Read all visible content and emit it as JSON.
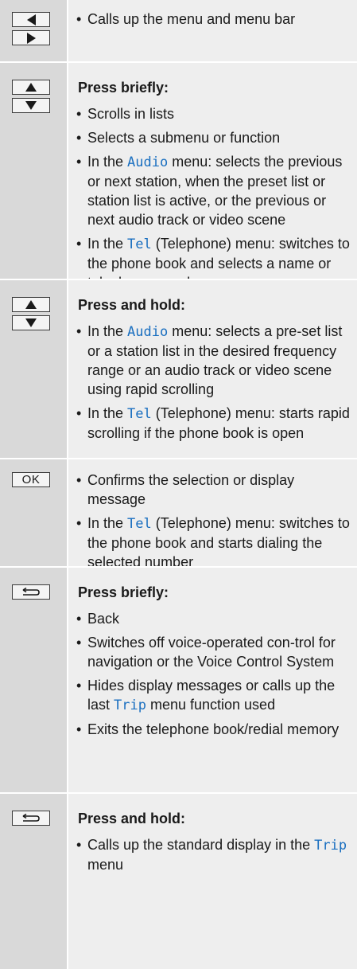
{
  "rows": [
    {
      "keys": [
        "left-arrow",
        "right-arrow"
      ],
      "heading": "",
      "items": [
        {
          "parts": [
            "Calls up the menu and menu bar"
          ]
        }
      ]
    },
    {
      "keys": [
        "up-arrow",
        "down-arrow"
      ],
      "heading": "Press briefly:",
      "items": [
        {
          "parts": [
            "Scrolls in lists"
          ]
        },
        {
          "parts": [
            "Selects a submenu or function"
          ]
        },
        {
          "pre": "In the ",
          "hl": "Audio",
          "post": " menu: selects the previous or next station, when the preset list or station list is active, or the previous or next audio track or video scene"
        },
        {
          "pre": "In the ",
          "hl": "Tel",
          "post": " (Telephone) menu: switches to the phone book and selects a name or telephone num-ber"
        }
      ]
    },
    {
      "keys": [
        "up-arrow",
        "down-arrow"
      ],
      "heading": "Press and hold:",
      "items": [
        {
          "pre": "In the ",
          "hl": "Audio",
          "post": " menu: selects a pre-set list or a station list in the desired frequency range or an audio track or video scene using rapid scrolling"
        },
        {
          "pre": "In the ",
          "hl": "Tel",
          "post": " (Telephone) menu: starts rapid scrolling if the phone book is open"
        }
      ]
    },
    {
      "keys": [
        "ok"
      ],
      "ok_label": "OK",
      "heading": "",
      "items": [
        {
          "parts": [
            "Confirms the selection or display message"
          ]
        },
        {
          "pre": "In the ",
          "hl": "Tel",
          "post": " (Telephone) menu: switches to the phone book and starts dialing the selected number"
        }
      ]
    },
    {
      "keys": [
        "back"
      ],
      "heading": "Press briefly:",
      "items": [
        {
          "parts": [
            "Back"
          ]
        },
        {
          "parts": [
            "Switches off voice-operated con-trol for navigation or the Voice Control System"
          ]
        },
        {
          "pre": "Hides display messages or calls up the last ",
          "hl": "Trip",
          "post": " menu function used"
        },
        {
          "parts": [
            "Exits the telephone book/redial memory"
          ]
        }
      ]
    },
    {
      "keys": [
        "back"
      ],
      "heading": "Press and hold:",
      "items": [
        {
          "pre": "Calls up the standard display in the ",
          "hl": "Trip",
          "post": " menu"
        }
      ]
    }
  ],
  "colors": {
    "highlight": "#1a6fc0",
    "key_column_bg": "#d9d9d9",
    "text_column_bg": "#eeeeee"
  }
}
